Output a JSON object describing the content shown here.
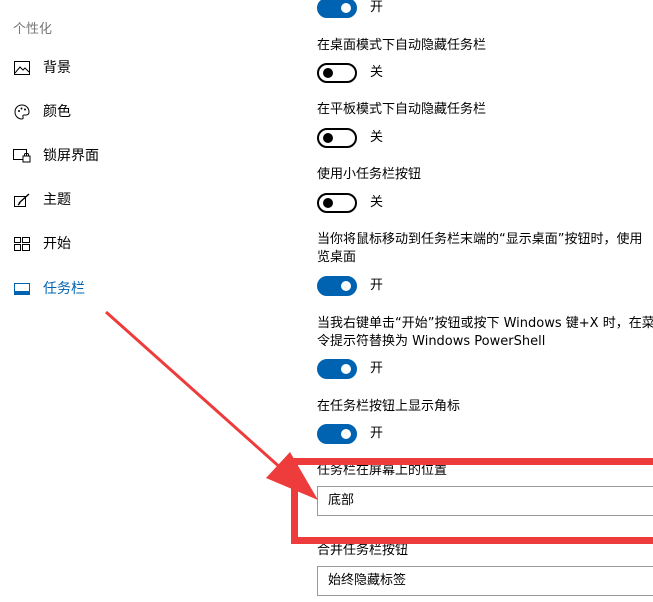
{
  "sidebar": {
    "section_title": "个性化",
    "items": [
      {
        "label": "背景",
        "icon": "picture-icon"
      },
      {
        "label": "颜色",
        "icon": "palette-icon"
      },
      {
        "label": "锁屏界面",
        "icon": "lock-screen-icon"
      },
      {
        "label": "主题",
        "icon": "theme-brush-icon"
      },
      {
        "label": "开始",
        "icon": "start-tiles-icon"
      },
      {
        "label": "任务栏",
        "icon": "taskbar-icon",
        "active": true
      }
    ]
  },
  "settings": {
    "top_toggle": {
      "state": "开"
    },
    "auto_hide_desktop": {
      "label": "在桌面模式下自动隐藏任务栏",
      "state": "关"
    },
    "auto_hide_tablet": {
      "label": "在平板模式下自动隐藏任务栏",
      "state": "关"
    },
    "small_buttons": {
      "label": "使用小任务栏按钮",
      "state": "关"
    },
    "peek": {
      "label_line1": "当你将鼠标移动到任务栏末端的“显示桌面”按钮时，使用",
      "label_line2": "览桌面",
      "state": "开"
    },
    "powershell": {
      "label_line1": "当我右键单击“开始”按钮或按下 Windows 键+X 时，在菜",
      "label_line2": "令提示符替换为 Windows PowerShell",
      "state": "开"
    },
    "badges": {
      "label": "在任务栏按钮上显示角标",
      "state": "开"
    },
    "location": {
      "label": "任务栏在屏幕上的位置",
      "value": "底部"
    },
    "combine": {
      "label": "合并任务栏按钮",
      "value": "始终隐藏标签"
    }
  },
  "colors": {
    "accent": "#0063b1",
    "annotation": "#ee3b3b"
  }
}
